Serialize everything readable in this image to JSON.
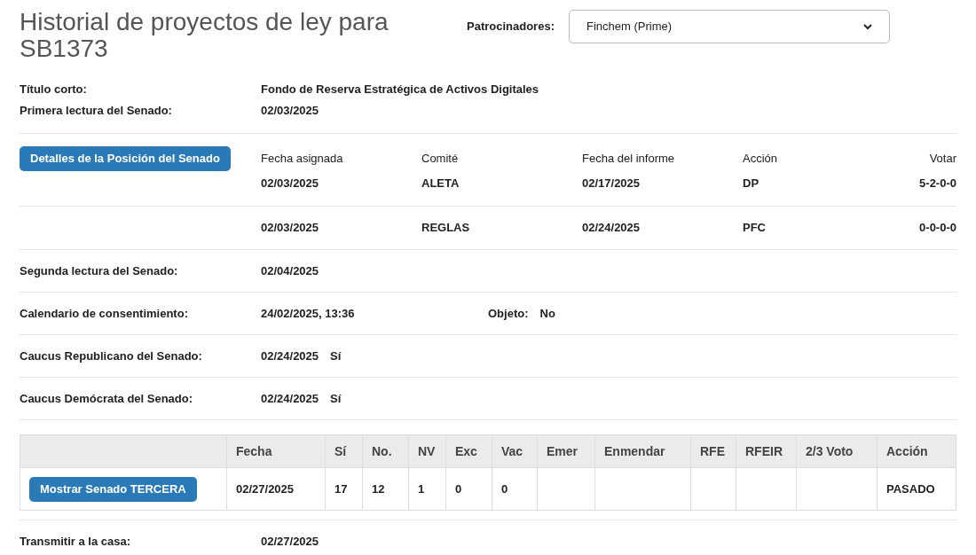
{
  "title": "Historial de proyectos de ley para SB1373",
  "sponsors": {
    "label": "Patrocinadores:",
    "value": "Finchem (Prime)"
  },
  "summary": [
    {
      "label": "Título corto:",
      "value": "Fondo de Reserva Estratégica de Activos Digitales"
    },
    {
      "label": "Primera lectura del Senado:",
      "value": "02/03/2025"
    }
  ],
  "committees": {
    "button": "Detalles de la Posición del Senado",
    "columns": [
      "Fecha asignada",
      "Comité",
      "Fecha del informe",
      "Acción",
      "Votar"
    ],
    "rows": [
      [
        "02/03/2025",
        "ALETA",
        "02/17/2025",
        "DP",
        "5-2-0-0"
      ],
      [
        "02/03/2025",
        "REGLAS",
        "02/24/2025",
        "PFC",
        "0-0-0-0"
      ]
    ]
  },
  "events": [
    {
      "kind": "date",
      "label": "Segunda lectura del Senado:",
      "value": "02/04/2025"
    },
    {
      "kind": "consent",
      "label": "Calendario de consentimiento:",
      "value": "24/02/2025, 13:36",
      "extra_label": "Objeto:",
      "extra_value": "No"
    },
    {
      "kind": "caucus",
      "label": "Caucus Republicano del Senado:",
      "value": "02/24/2025",
      "extra_value": "Sí"
    },
    {
      "kind": "caucus",
      "label": "Caucus Demócrata del Senado:",
      "value": "02/24/2025",
      "extra_value": "Sí"
    }
  ],
  "votes": {
    "columns": [
      "Fecha",
      "Sí",
      "No.",
      "NV",
      "Exc",
      "Vac",
      "Emer",
      "Enmendar",
      "RFE",
      "RFEIR",
      "2/3 Voto",
      "Acción"
    ],
    "rows": [
      {
        "button": "Mostrar Senado TERCERA",
        "cells": [
          "02/27/2025",
          "17",
          "12",
          "1",
          "0",
          "0",
          "",
          "",
          "",
          "",
          "",
          "PASADO"
        ]
      }
    ]
  },
  "transmit": {
    "label": "Transmitir a la casa:",
    "value": "02/27/2025"
  }
}
